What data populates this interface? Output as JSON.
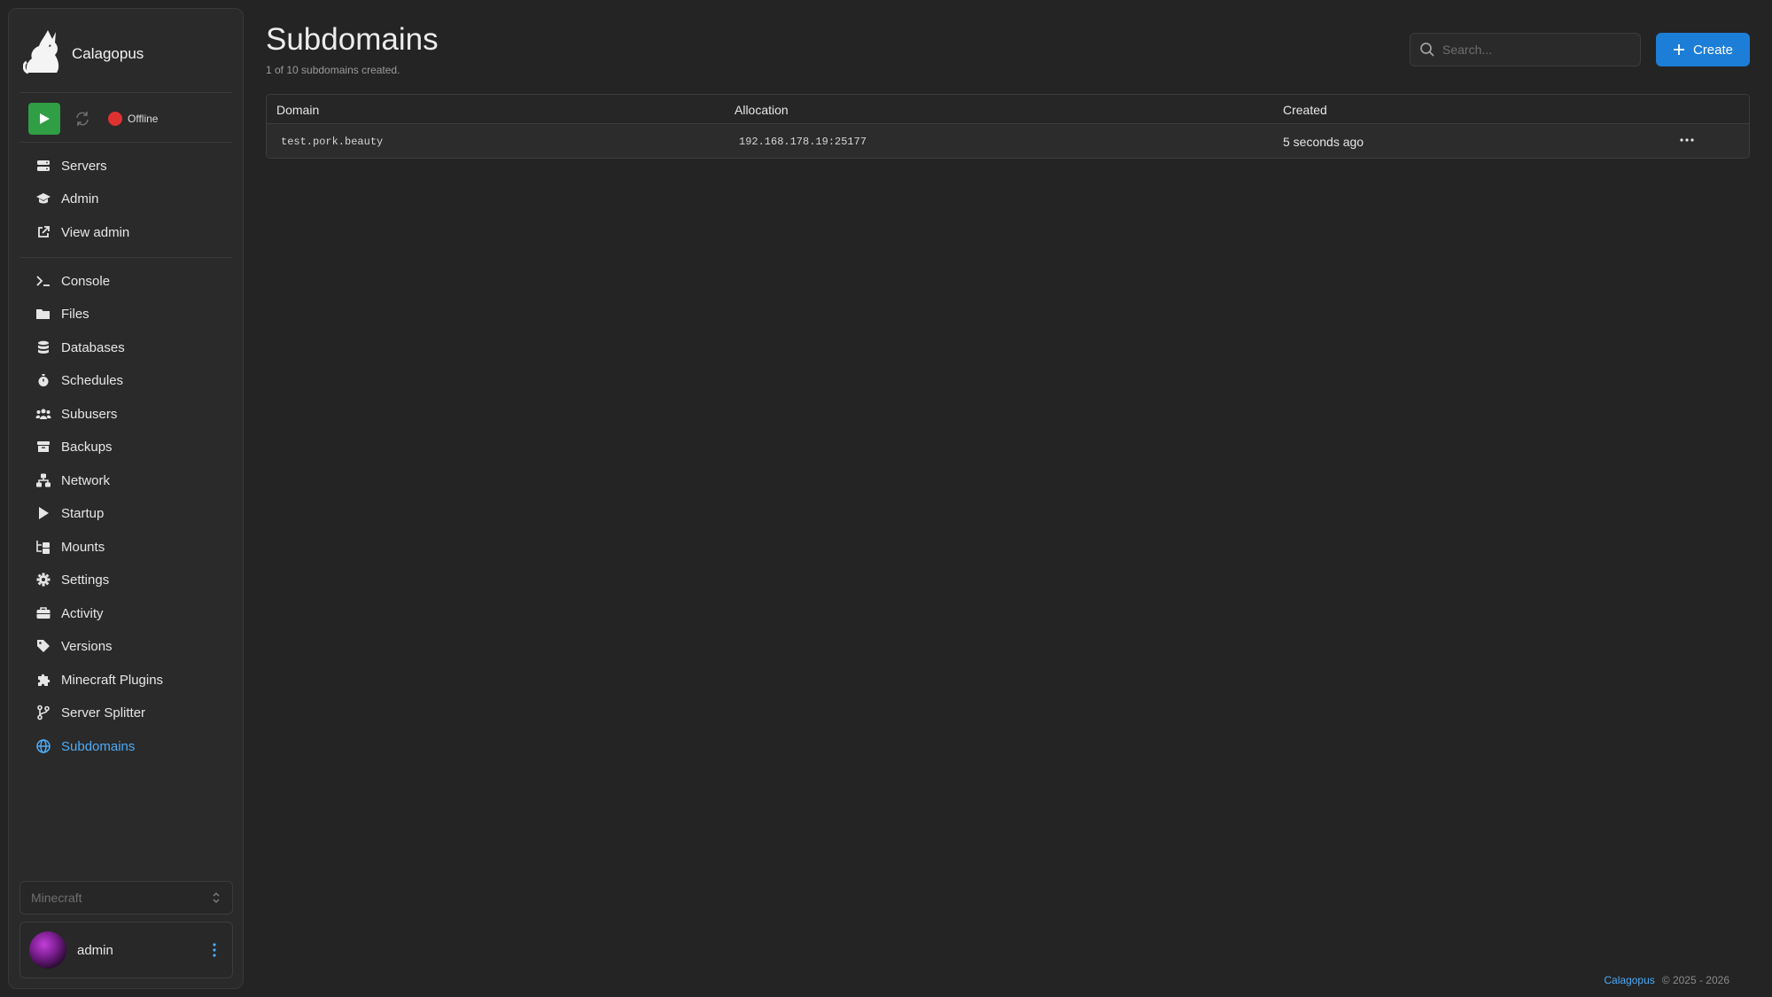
{
  "app": {
    "name": "Calagopus"
  },
  "server": {
    "status": "Offline"
  },
  "nav": {
    "primary": [
      {
        "label": "Servers",
        "icon": "servers-icon"
      },
      {
        "label": "Admin",
        "icon": "graduation-cap-icon"
      },
      {
        "label": "View admin",
        "icon": "external-link-icon"
      }
    ],
    "server": [
      {
        "label": "Console",
        "icon": "terminal-icon"
      },
      {
        "label": "Files",
        "icon": "folder-icon"
      },
      {
        "label": "Databases",
        "icon": "database-icon"
      },
      {
        "label": "Schedules",
        "icon": "stopwatch-icon"
      },
      {
        "label": "Subusers",
        "icon": "users-icon"
      },
      {
        "label": "Backups",
        "icon": "archive-icon"
      },
      {
        "label": "Network",
        "icon": "network-icon"
      },
      {
        "label": "Startup",
        "icon": "play-icon"
      },
      {
        "label": "Mounts",
        "icon": "folder-tree-icon"
      },
      {
        "label": "Settings",
        "icon": "gear-icon"
      },
      {
        "label": "Activity",
        "icon": "briefcase-icon"
      },
      {
        "label": "Versions",
        "icon": "tag-icon"
      },
      {
        "label": "Minecraft Plugins",
        "icon": "puzzle-icon"
      },
      {
        "label": "Server Splitter",
        "icon": "code-branch-icon"
      },
      {
        "label": "Subdomains",
        "icon": "globe-icon",
        "active": true
      }
    ]
  },
  "server_select": {
    "value": "Minecraft"
  },
  "user": {
    "name": "admin"
  },
  "page": {
    "title": "Subdomains",
    "subtitle": "1 of 10 subdomains created."
  },
  "search": {
    "placeholder": "Search..."
  },
  "create_button": {
    "label": "Create"
  },
  "table": {
    "columns": [
      "Domain",
      "Allocation",
      "Created"
    ],
    "rows": [
      {
        "domain": "test.pork.beauty",
        "allocation": "192.168.178.19:25177",
        "created": "5 seconds ago"
      }
    ]
  },
  "footer": {
    "link": "Calagopus",
    "copyright": "© 2025 - 2026"
  },
  "colors": {
    "accent": "#1c7ed6",
    "active_nav": "#4dabf7",
    "start_button": "#2f9e44",
    "offline_dot": "#e03131",
    "background": "#242424"
  }
}
